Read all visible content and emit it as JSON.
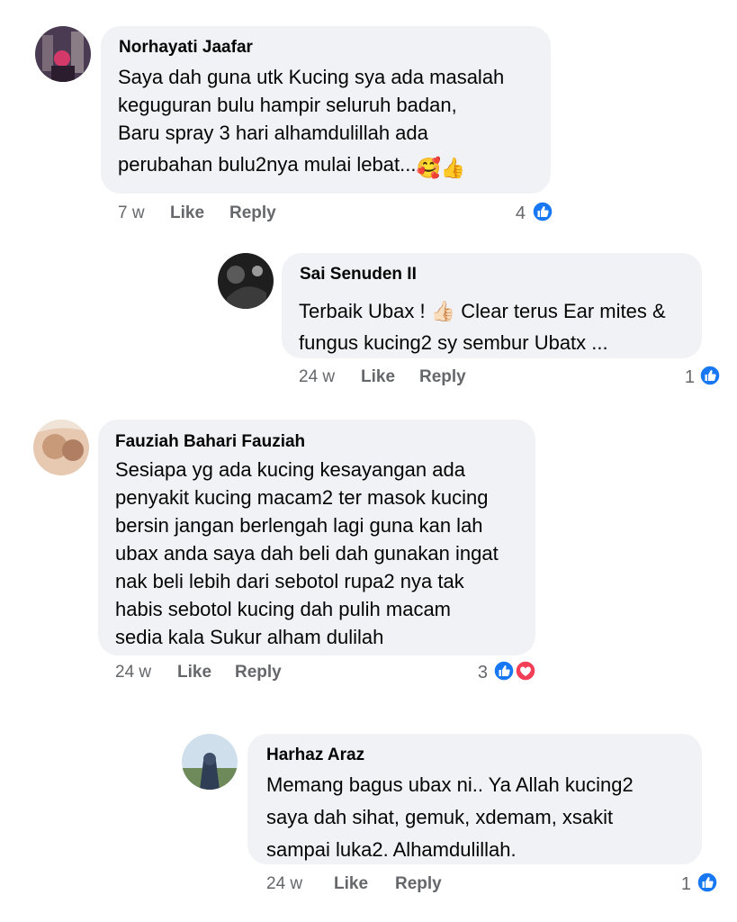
{
  "comments": [
    {
      "author": "Norhayati Jaafar",
      "lines": [
        "Saya dah guna utk Kucing sya ada masalah",
        "keguguran bulu hampir seluruh badan,",
        "Baru spray 3 hari alhamdulillah ada",
        "perubahan bulu2nya mulai lebat..."
      ],
      "emojis": "🥰👍",
      "time": "7 w",
      "like": "Like",
      "reply": "Reply",
      "reactions": "4"
    },
    {
      "author": "Sai Senuden II",
      "lines": [
        "Terbaik Ubax ! 👍🏻 Clear terus Ear mites &",
        "fungus kucing2 sy sembur Ubatx ..."
      ],
      "time": "24 w",
      "like": "Like",
      "reply": "Reply",
      "reactions": "1"
    },
    {
      "author": "Fauziah Bahari Fauziah",
      "lines": [
        "Sesiapa yg ada kucing kesayangan ada",
        "penyakit kucing macam2 ter masok kucing",
        "bersin jangan berlengah lagi guna kan lah",
        "ubax anda saya dah beli dah gunakan ingat",
        "nak beli lebih dari sebotol rupa2 nya tak",
        "habis sebotol kucing dah pulih macam",
        "sedia kala Sukur alham dulilah"
      ],
      "time": "24 w",
      "like": "Like",
      "reply": "Reply",
      "reactions": "3"
    },
    {
      "author": "Harhaz Araz",
      "lines": [
        "Memang bagus ubax ni.. Ya Allah kucing2",
        "saya dah sihat, gemuk, xdemam, xsakit",
        "sampai luka2. Alhamdulillah."
      ],
      "time": "24 w",
      "like": "Like",
      "reply": "Reply",
      "reactions": "1"
    }
  ],
  "colors": {
    "bubble": "#f0f2f5",
    "meta": "#65676b",
    "like_blue": "#1877f2",
    "love_red": "#f33e58"
  }
}
